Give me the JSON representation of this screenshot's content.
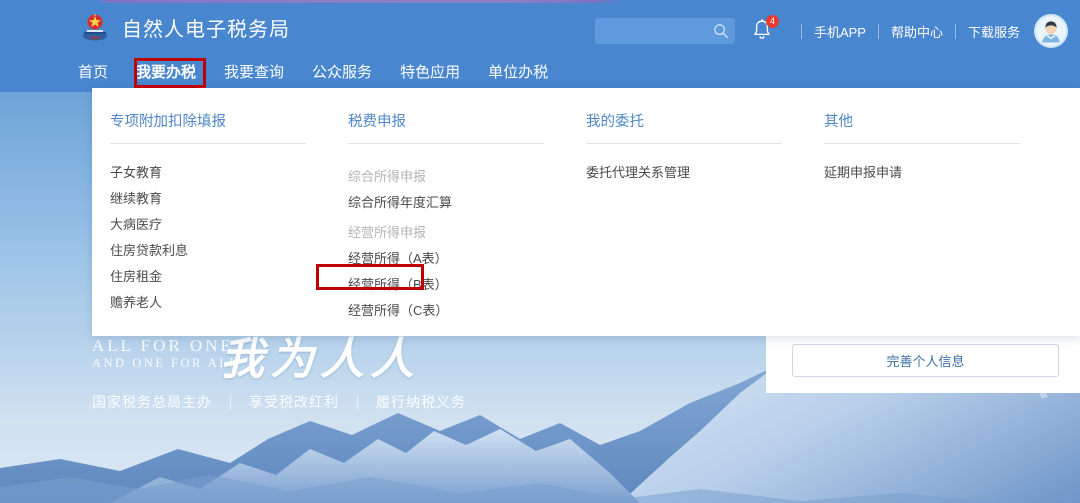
{
  "header": {
    "brand_title": "自然人电子税务局",
    "logo_icon": "tax-bureau-emblem-icon",
    "search": {
      "placeholder": "",
      "value": "",
      "icon": "search-icon"
    },
    "notification": {
      "icon": "bell-icon",
      "badge_count": "4"
    },
    "links": [
      {
        "label": "手机APP"
      },
      {
        "label": "帮助中心"
      },
      {
        "label": "下载服务"
      }
    ],
    "avatar_icon": "user-avatar-icon",
    "bg_color": "#4886d0"
  },
  "nav": {
    "items": [
      {
        "label": "首页",
        "active": false
      },
      {
        "label": "我要办税",
        "active": true
      },
      {
        "label": "我要查询",
        "active": false
      },
      {
        "label": "公众服务",
        "active": false
      },
      {
        "label": "特色应用",
        "active": false
      },
      {
        "label": "单位办税",
        "active": false
      }
    ],
    "highlight_color": "#c00000",
    "highlighted_item": "我要办税"
  },
  "dropdown": {
    "columns": [
      {
        "title": "专项附加扣除填报",
        "items": [
          {
            "label": "子女教育",
            "type": "link"
          },
          {
            "label": "继续教育",
            "type": "link"
          },
          {
            "label": "大病医疗",
            "type": "link"
          },
          {
            "label": "住房贷款利息",
            "type": "link"
          },
          {
            "label": "住房租金",
            "type": "link"
          },
          {
            "label": "赡养老人",
            "type": "link"
          }
        ]
      },
      {
        "title": "税费申报",
        "items": [
          {
            "label": "综合所得申报",
            "type": "group"
          },
          {
            "label": "综合所得年度汇算",
            "type": "link"
          },
          {
            "label": "经营所得申报",
            "type": "group"
          },
          {
            "label": "经营所得（A表）",
            "type": "link"
          },
          {
            "label": "经营所得（B表）",
            "type": "link",
            "highlighted": true
          },
          {
            "label": "经营所得（C表）",
            "type": "link"
          }
        ]
      },
      {
        "title": "我的委托",
        "items": [
          {
            "label": "委托代理关系管理",
            "type": "link"
          }
        ]
      },
      {
        "title": "其他",
        "items": [
          {
            "label": "延期申报申请",
            "type": "link"
          }
        ]
      }
    ],
    "highlighted_item": "经营所得（B表）",
    "highlight_color": "#c00000"
  },
  "right_card": {
    "button_label": "完善个人信息"
  },
  "slogan": {
    "en_line1": "ALL  FOR  ONE",
    "en_line2": "AND ONE FOR ALL",
    "cn": "我为人人",
    "footer": [
      {
        "label": "国家税务总局主办"
      },
      {
        "label": "享受税改红利"
      },
      {
        "label": "履行纳税义务"
      }
    ]
  }
}
